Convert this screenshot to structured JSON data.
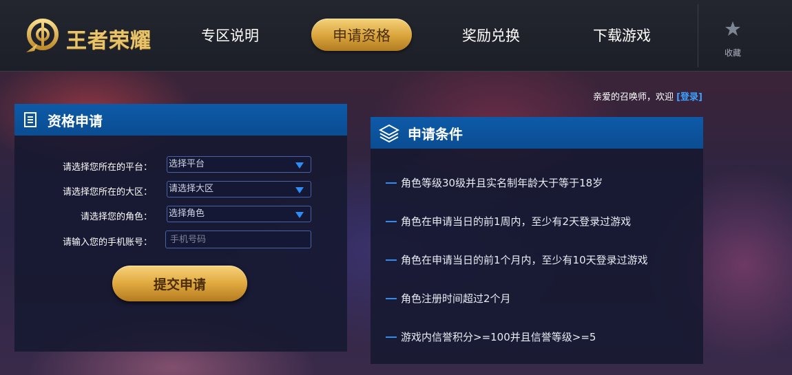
{
  "header": {
    "logo_text": "王者荣耀",
    "nav": [
      {
        "label": "专区说明"
      },
      {
        "label": "申请资格"
      },
      {
        "label": "奖励兑换"
      },
      {
        "label": "下载游戏"
      }
    ],
    "active_index": 1,
    "favorite_label": "收藏",
    "accent_color": "#e0a93f"
  },
  "welcome": {
    "text": "亲爱的召唤师，欢迎",
    "login_link": "[登录]"
  },
  "apply_panel": {
    "title": "资格申请",
    "fields": [
      {
        "label": "请选择您所在的平台：",
        "value": "选择平台"
      },
      {
        "label": "请选择您所在的大区：",
        "value": "请选择大区"
      },
      {
        "label": "请选择您的角色：",
        "value": "选择角色"
      }
    ],
    "phone": {
      "label": "请输入您的手机账号：",
      "placeholder": "手机号码"
    },
    "submit_label": "提交申请"
  },
  "conditions_panel": {
    "title": "申请条件",
    "items": [
      "角色等级30级并且实名制年龄大于等于18岁",
      "角色在申请当日的前1周内，至少有2天登录过游戏",
      "角色在申请当日的前1个月内，至少有10天登录过游戏",
      "角色注册时间超过2个月",
      "游戏内信誉积分>=100并且信誉等级>=5"
    ]
  }
}
